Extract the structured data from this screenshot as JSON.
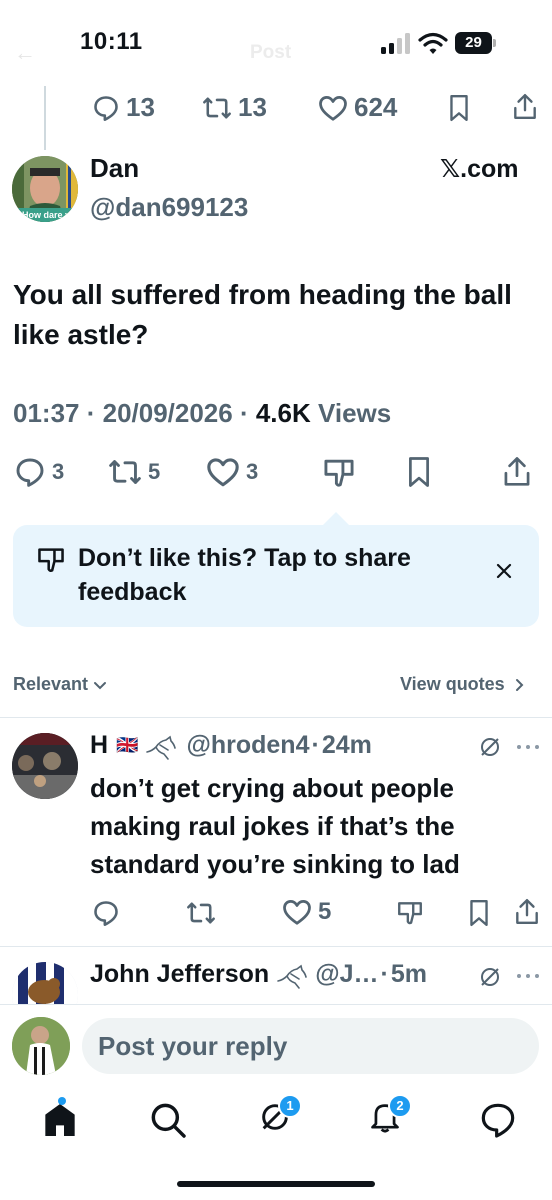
{
  "status_bar": {
    "time": "10:11",
    "battery": "29"
  },
  "ghost_header": {
    "back": "←",
    "title": "Post"
  },
  "parent_actions": {
    "replies": "13",
    "reposts": "13",
    "likes": "624"
  },
  "main_tweet": {
    "name": "Dan",
    "handle": "@dan699123",
    "source": "𝕏.com",
    "avatar_caption": "How dare y",
    "text": "You all suffered from heading the ball like astle?",
    "time": "01:37 · 20/09/2026 · ",
    "views_count": "4.6K",
    "views_label": " Views",
    "replies": "3",
    "reposts": "5",
    "likes": "3"
  },
  "feedback": {
    "text": "Don’t like this? Tap to share feedback"
  },
  "sort": {
    "relevant": "Relevant",
    "view_quotes": "View quotes"
  },
  "replies": [
    {
      "name": "H",
      "flag": "🇬🇧",
      "handle": "@hroden4",
      "sep": "·",
      "time": "24m",
      "text": "don’t get crying about people making raul jokes if that’s the standard you’re sinking to lad",
      "likes": "5"
    },
    {
      "name": "John Jefferson",
      "handle": "@J…",
      "sep": "·",
      "time": "5m"
    }
  ],
  "compose": {
    "placeholder": "Post your reply"
  },
  "nav": {
    "grok_badge": "1",
    "notifications_badge": "2"
  },
  "colors": {
    "accent": "#1d9bf0",
    "text": "#0f1419",
    "muted": "#536471",
    "feedback_bg": "#e8f5fd"
  },
  "icons": [
    "signal-icon",
    "wifi-icon",
    "battery-icon",
    "reply-icon",
    "repost-icon",
    "like-icon",
    "dislike-icon",
    "bookmark-icon",
    "share-icon",
    "close-icon",
    "chevron-down-icon",
    "chevron-right-icon",
    "bird-icon",
    "flag-icon",
    "grok-icon",
    "more-icon",
    "home-icon",
    "search-icon",
    "bell-icon",
    "messages-icon"
  ]
}
